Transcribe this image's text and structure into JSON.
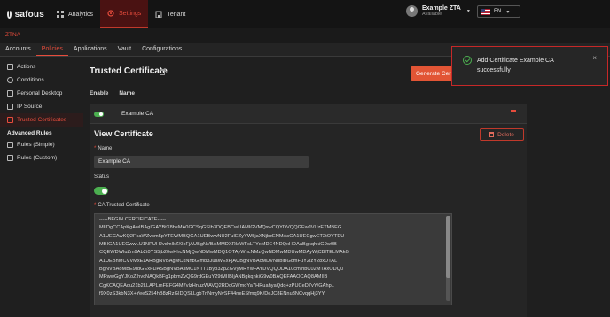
{
  "app": {
    "logo_text": "safous"
  },
  "topnav": [
    {
      "label": "Analytics",
      "icon": "grid-icon",
      "active": false
    },
    {
      "label": "Settings",
      "icon": "gear-icon",
      "active": true
    },
    {
      "label": "Tenant",
      "icon": "building-icon",
      "active": false
    }
  ],
  "user": {
    "name": "Example ZTA",
    "status": "Available"
  },
  "language": {
    "code": "EN",
    "flag": "us-flag-icon"
  },
  "breadcrumb": "ZTNA",
  "subnav": [
    {
      "label": "Accounts",
      "active": false
    },
    {
      "label": "Policies",
      "active": true
    },
    {
      "label": "Applications",
      "active": false
    },
    {
      "label": "Vault",
      "active": false
    },
    {
      "label": "Configurations",
      "active": false
    }
  ],
  "sidebar": {
    "items": [
      {
        "label": "Actions",
        "active": false
      },
      {
        "label": "Conditions",
        "active": false
      },
      {
        "label": "Personal Desktop",
        "active": false
      },
      {
        "label": "IP Source",
        "active": false
      },
      {
        "label": "Trusted Certificates",
        "active": true
      }
    ],
    "section_title": "Advanced Rules",
    "advanced": [
      {
        "label": "Rules (Simple)"
      },
      {
        "label": "Rules (Custom)"
      }
    ]
  },
  "page": {
    "title": "Trusted Certificate",
    "generate_label": "Generate Cer",
    "columns": {
      "enable": "Enable",
      "name": "Name"
    },
    "row": {
      "name": "Example CA",
      "enabled": true
    }
  },
  "detail": {
    "title": "View Certificate",
    "delete_label": "Delete",
    "name_label": "Name",
    "name_value": "Example CA",
    "status_label": "Status",
    "cert_label": "CA Trusted Certificate",
    "cert_lines": [
      "-----BEGIN CERTIFICATE-----",
      "MIIDgCCApKgAwIBAgIGAYBtX8bsMA0GCSqGSIb3DQEBCwUAMIGVMQswCQYDVQQGEwJVUzETMBEG",
      "A1UECAwKQ2FsaWZvcm5pYTEWMBQGA1UEBwwNU2FuIEZyYW5jaXNjbzENMAsGA1UECgwET2tOYTEU",
      "MBIGA1UECwwLU1NPUHJvdmlkZXIxFjAUBgNVBAMMDXRlaWFsLTYxMDE4NDQxHDAaBgkqhkiG9w0B",
      "CQEWDWluZm9Ab2t0YS5jb20wHhcNMjQwNDMwMDQ1OTAyWhcNMzQwNDMwMDUwMDAyWjCBlTELMAkG",
      "A1UEBhMCVVMxEzARBgNVBAgMCkNhbGlmb3JuaWExFjAUBgNVBAcMDVNhbiBGcmFuY2lzY28xDTAL",
      "BgNVBAoMBE9rdGExFDASBgNVBAsMC1NTT1Byb3ZpZGVyMRYwFAYDVQQDDA10cmlhbC02MTAxODQ0",
      "MRwwGgYJKoZIhvcNAQkBFg1pbmZvQG9rdGEuY29tMIIBIjANBgkqhkiG9w0BAQEFAAOCAQ8AMIIB",
      "CgKCAQEAqu21b2LLAPLmFEFG4M7vlzHnuzWAVQ2RDcGWmoYa7HRuahyaQdq+zPUCeD7vY/GAhpL",
      "f9X0zS3kbN3X+YeeS254hB8zRzGIDQSLLgbTnNmyNvSF44neESfmq9K/DeJC8ENnu3NCvqqHj3YY"
    ]
  },
  "toast": {
    "message": "Add Certificate Example CA successfully",
    "close_glyph": "×"
  }
}
